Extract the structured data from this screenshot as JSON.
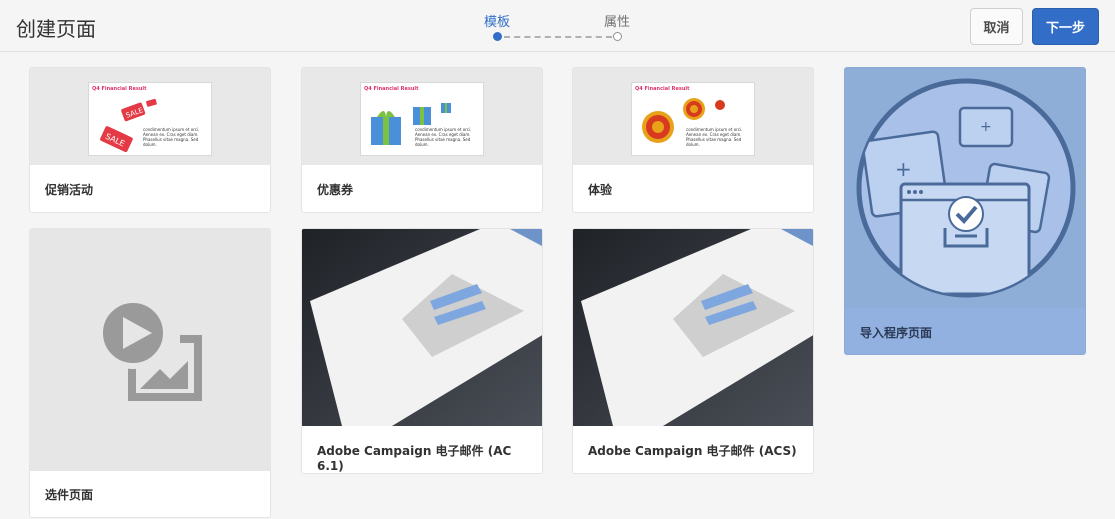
{
  "header": {
    "title": "创建页面",
    "steps": [
      "模板",
      "属性"
    ],
    "cancel_label": "取消",
    "next_label": "下一步"
  },
  "doc_preview": {
    "title": "Q4 Financial Result",
    "body": "condimentum ipsum et orci. Aenean ex. Cras eget diam. Phasellus vitae magna. Sed dolum."
  },
  "cards": [
    {
      "label": "促销活动",
      "thumb": "sale-tags"
    },
    {
      "label": "优惠券",
      "thumb": "gift-boxes"
    },
    {
      "label": "体验",
      "thumb": "targets"
    },
    {
      "label": "导入程序页面",
      "thumb": "import-pages",
      "selected": true
    },
    {
      "label": "选件页面",
      "thumb": "play-image"
    },
    {
      "label": "Adobe Campaign 电子邮件 (AC 6.1)",
      "thumb": "email-envelope"
    },
    {
      "label": "Adobe Campaign 电子邮件 (ACS)",
      "thumb": "email-envelope"
    }
  ],
  "colors": {
    "accent": "#326ec8",
    "selected": "#93b1e0"
  }
}
